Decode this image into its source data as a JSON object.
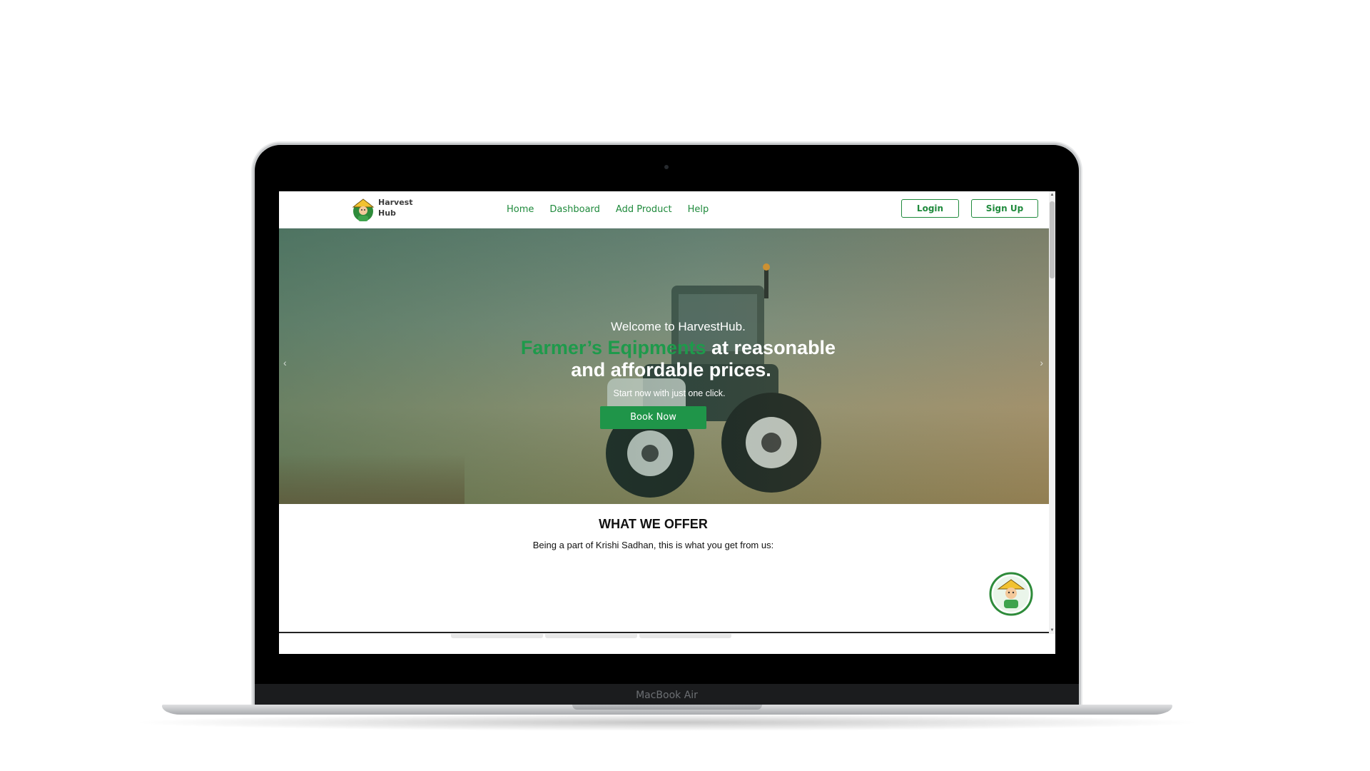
{
  "device": {
    "model_label": "MacBook Air"
  },
  "navbar": {
    "brand_line1": "Harvest",
    "brand_line2": "Hub",
    "links": [
      {
        "label": "Home"
      },
      {
        "label": "Dashboard"
      },
      {
        "label": "Add Product"
      },
      {
        "label": "Help"
      }
    ],
    "login_label": "Login",
    "signup_label": "Sign Up"
  },
  "hero": {
    "welcome": "Welcome to HarvestHub.",
    "headline_green": "Farmer’s Eqipments",
    "headline_rest_1": " at reasonable",
    "headline_rest_2": "and affordable prices.",
    "subtext": "Start now with just one click.",
    "cta_label": "Book Now",
    "prev_icon": "‹",
    "next_icon": "›"
  },
  "offer": {
    "title": "WHAT WE OFFER",
    "subtitle": "Being a part of Krishi Sadhan, this is what you get from us:"
  },
  "colors": {
    "brand_green": "#1f8a3c",
    "hero_green": "#1e9a4b",
    "cta_green": "#1f9549"
  }
}
